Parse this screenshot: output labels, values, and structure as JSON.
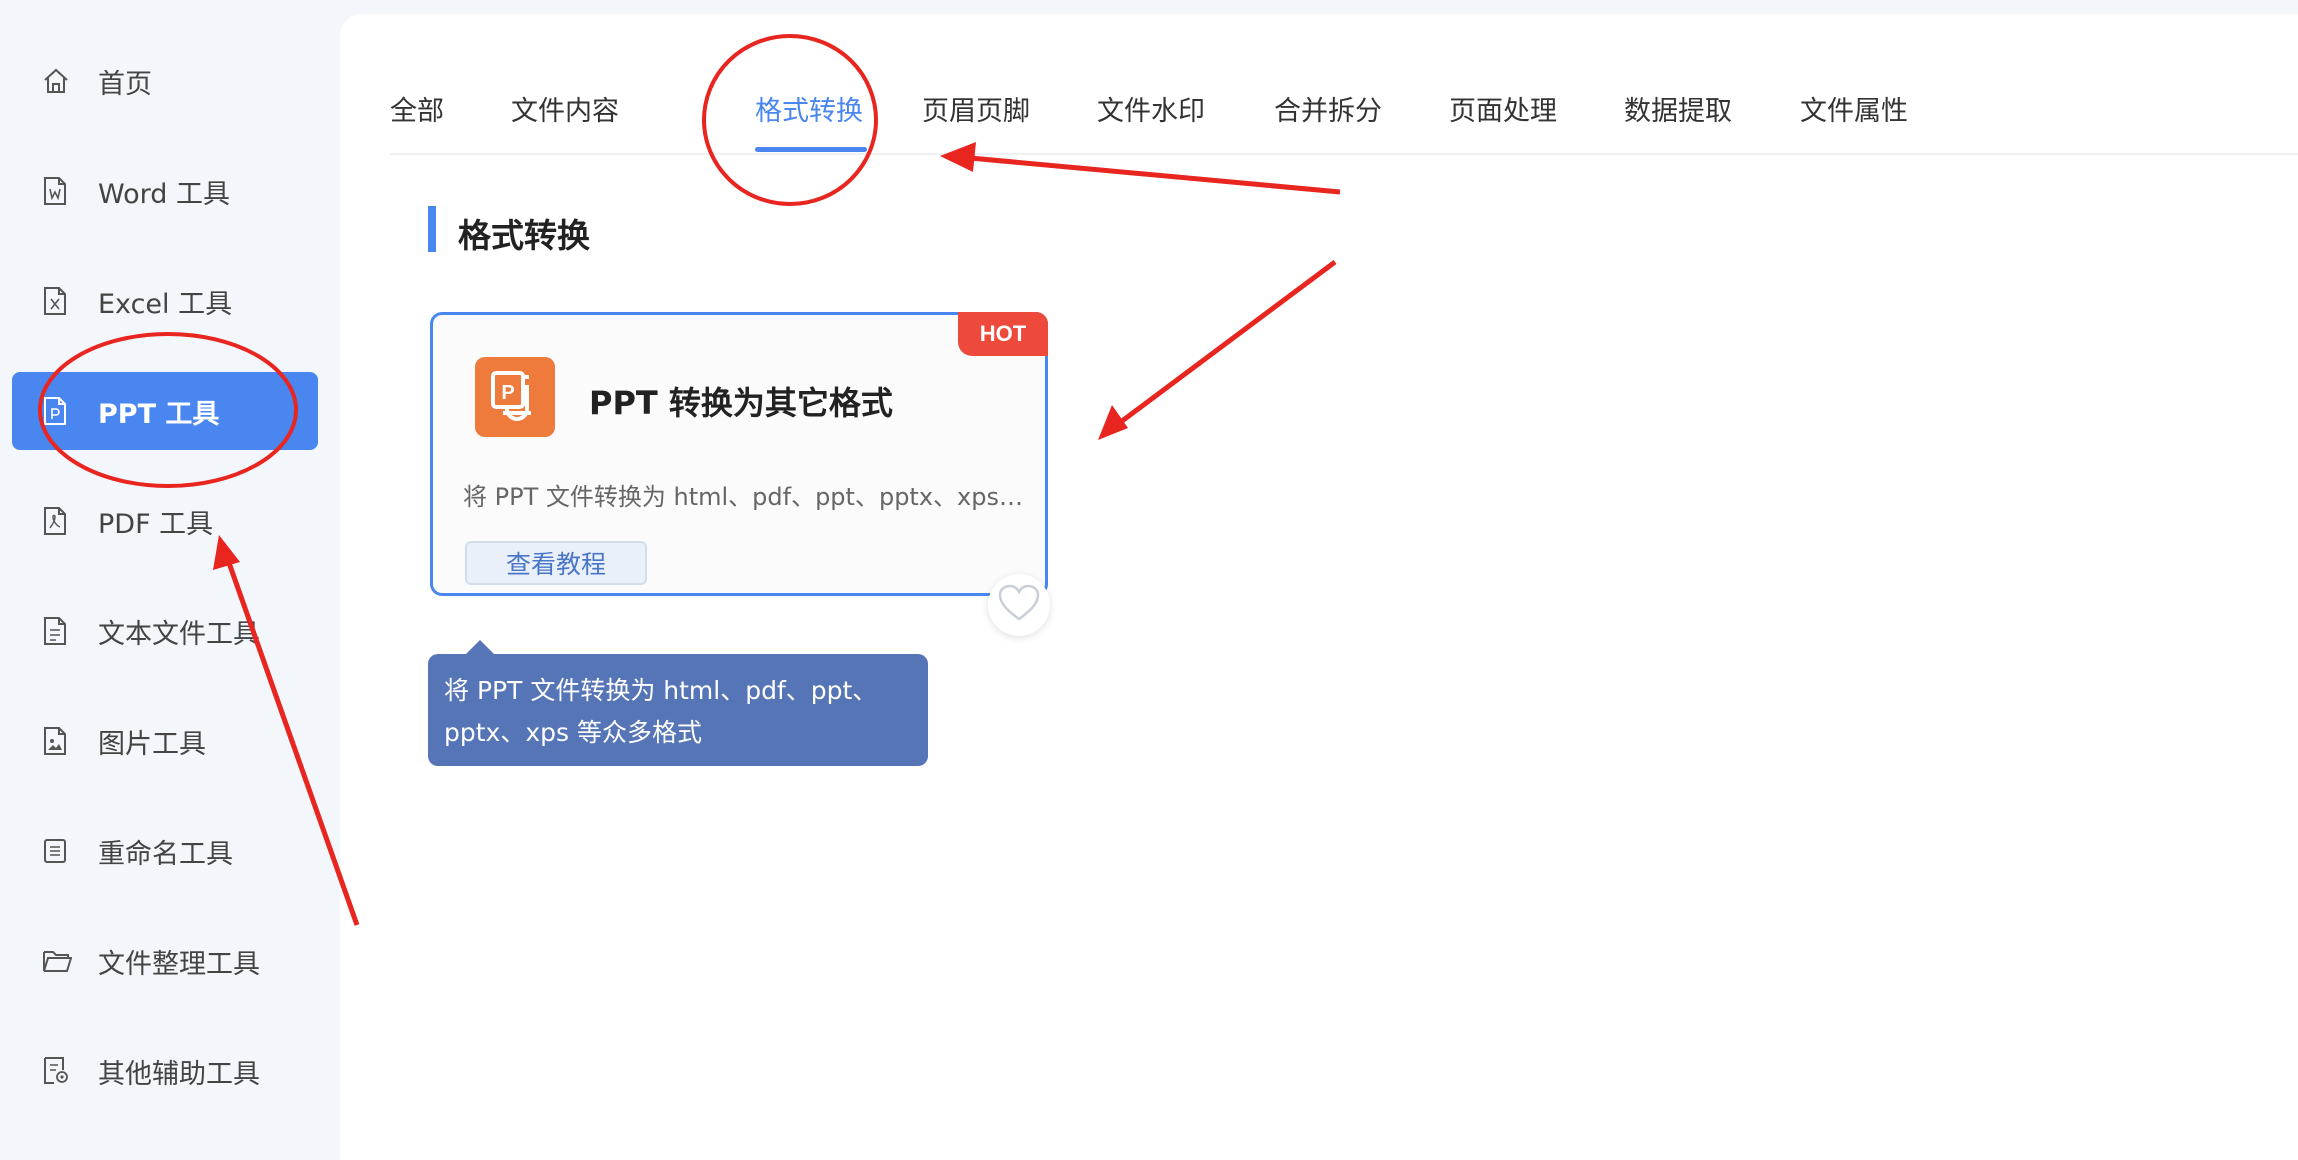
{
  "sidebar": {
    "items": [
      {
        "label": "首页",
        "icon": "home-icon"
      },
      {
        "label": "Word 工具",
        "icon": "word-file-icon"
      },
      {
        "label": "Excel 工具",
        "icon": "excel-file-icon"
      },
      {
        "label": "PPT 工具",
        "icon": "ppt-file-icon",
        "active": true
      },
      {
        "label": "PDF 工具",
        "icon": "pdf-file-icon"
      },
      {
        "label": "文本文件工具",
        "icon": "text-file-icon"
      },
      {
        "label": "图片工具",
        "icon": "image-file-icon"
      },
      {
        "label": "重命名工具",
        "icon": "rename-icon"
      },
      {
        "label": "文件整理工具",
        "icon": "folder-icon"
      },
      {
        "label": "其他辅助工具",
        "icon": "other-tools-icon"
      }
    ]
  },
  "tabs": [
    {
      "label": "全部"
    },
    {
      "label": "文件内容"
    },
    {
      "label": "格式转换",
      "active": true
    },
    {
      "label": "页眉页脚"
    },
    {
      "label": "文件水印"
    },
    {
      "label": "合并拆分"
    },
    {
      "label": "页面处理"
    },
    {
      "label": "数据提取"
    },
    {
      "label": "文件属性"
    }
  ],
  "section": {
    "title": "格式转换"
  },
  "card": {
    "badge": "HOT",
    "icon": "ppt-app-icon",
    "title": "PPT 转换为其它格式",
    "description": "将 PPT 文件转换为 html、pdf、ppt、pptx、xps 等众多格式",
    "tutorial_label": "查看教程",
    "favorite_icon": "heart-icon"
  },
  "tooltip": {
    "line1": "将 PPT 文件转换为 html、pdf、ppt、",
    "line2": "pptx、xps 等众多格式"
  },
  "colors": {
    "accent": "#4a86f0",
    "hot": "#ee4a3b",
    "ppt_icon": "#ee7a3c",
    "tooltip_bg": "#5575b6",
    "annotation": "#e8251f"
  }
}
